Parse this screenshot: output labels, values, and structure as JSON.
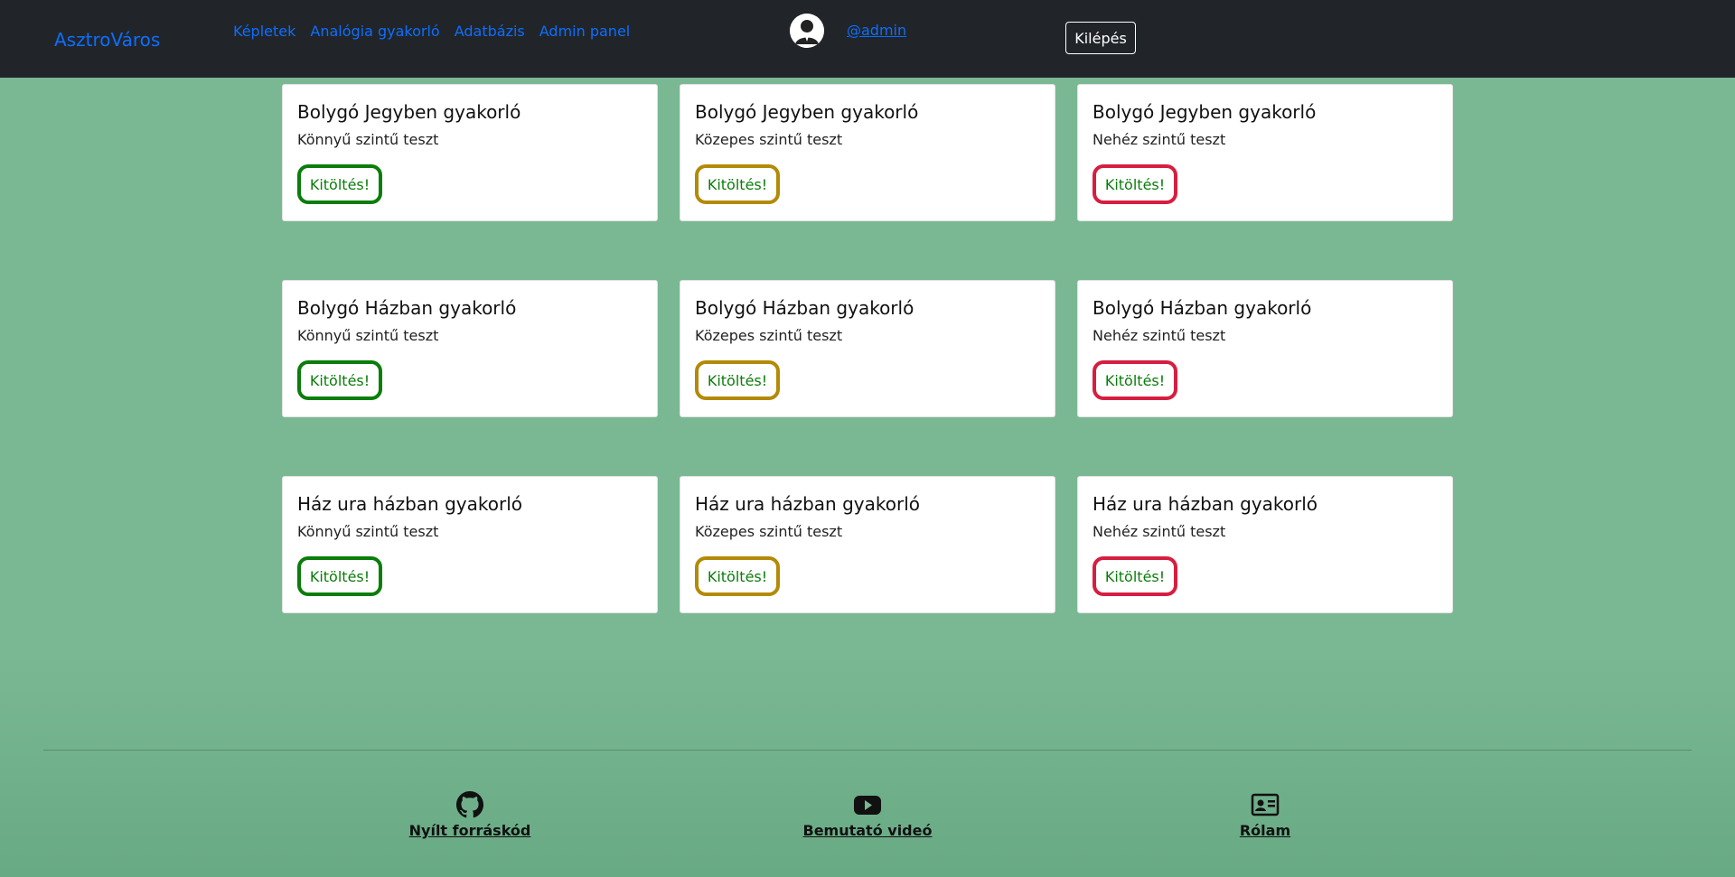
{
  "nav": {
    "brand": "AsztroVáros",
    "links": [
      "Képletek",
      "Analógia gyakorló",
      "Adatbázis",
      "Admin panel"
    ],
    "username": "@admin",
    "logout": "Kilépés"
  },
  "cards": [
    {
      "title": "Bolygó Jegyben gyakorló",
      "level": "Könnyű szintű teszt",
      "button": "Kitöltés!",
      "color": "#0a7d0a"
    },
    {
      "title": "Bolygó Jegyben gyakorló",
      "level": "Közepes szintű teszt",
      "button": "Kitöltés!",
      "color": "#b38a08"
    },
    {
      "title": "Bolygó Jegyben gyakorló",
      "level": "Nehéz szintű teszt",
      "button": "Kitöltés!",
      "color": "#d61e40"
    },
    {
      "title": "Bolygó Házban gyakorló",
      "level": "Könnyű szintű teszt",
      "button": "Kitöltés!",
      "color": "#0a7d0a"
    },
    {
      "title": "Bolygó Házban gyakorló",
      "level": "Közepes szintű teszt",
      "button": "Kitöltés!",
      "color": "#b38a08"
    },
    {
      "title": "Bolygó Házban gyakorló",
      "level": "Nehéz szintű teszt",
      "button": "Kitöltés!",
      "color": "#d61e40"
    },
    {
      "title": "Ház ura házban gyakorló",
      "level": "Könnyű szintű teszt",
      "button": "Kitöltés!",
      "color": "#0a7d0a"
    },
    {
      "title": "Ház ura házban gyakorló",
      "level": "Közepes szintű teszt",
      "button": "Kitöltés!",
      "color": "#b38a08"
    },
    {
      "title": "Ház ura házban gyakorló",
      "level": "Nehéz szintű teszt",
      "button": "Kitöltés!",
      "color": "#d61e40"
    }
  ],
  "footer": [
    {
      "label": "Nyílt forráskód",
      "icon": "github-icon"
    },
    {
      "label": "Bemutató videó",
      "icon": "youtube-icon"
    },
    {
      "label": "Rólam",
      "icon": "id-card-icon"
    }
  ]
}
